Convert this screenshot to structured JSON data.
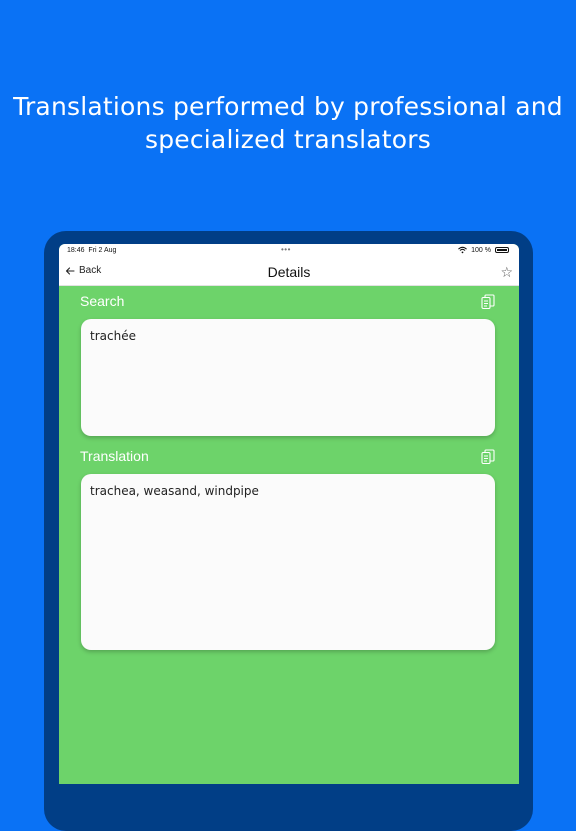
{
  "promo": {
    "headline": "Translations performed by professional and specialized translators"
  },
  "status_bar": {
    "time": "18:46",
    "date": "Fri 2 Aug",
    "battery": "100 %",
    "wifi_icon": "wifi-icon",
    "battery_icon": "battery-icon"
  },
  "nav": {
    "back_label": "Back",
    "back_icon": "back-arrow-icon",
    "title": "Details",
    "favorite_icon": "star-icon"
  },
  "search": {
    "label": "Search",
    "text": "trachée",
    "copy_icon": "copy-icon"
  },
  "translation": {
    "label": "Translation",
    "text": "trachea, weasand, windpipe",
    "copy_icon": "copy-icon"
  },
  "colors": {
    "background": "#0a72f5",
    "device_frame": "#013e86",
    "screen_accent": "#6dd36a",
    "card": "#fbfbfb"
  }
}
